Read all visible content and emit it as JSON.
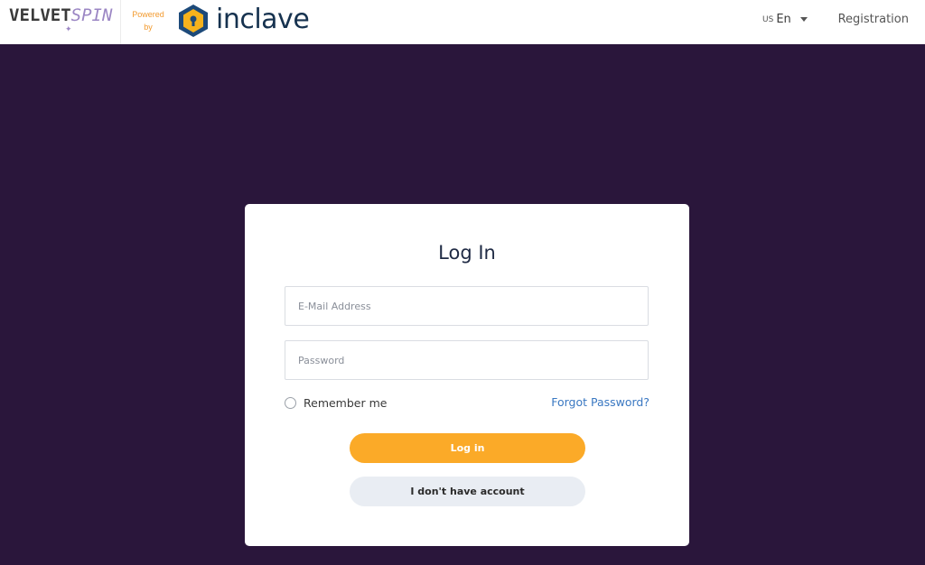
{
  "header": {
    "brand": {
      "part1": "VELVET",
      "part2": "SPIN"
    },
    "powered_by": {
      "line1": "Powered",
      "line2": "by"
    },
    "partner": "inclave",
    "language": {
      "flag": "US",
      "label": "En"
    },
    "registration": "Registration"
  },
  "login": {
    "title": "Log In",
    "email_placeholder": "E-Mail Address",
    "password_placeholder": "Password",
    "remember_label": "Remember me",
    "forgot_label": "Forgot Password?",
    "login_button": "Log in",
    "no_account_button": "I don't have account"
  },
  "colors": {
    "background": "#2a163b",
    "accent": "#fbaa28",
    "link": "#3a78c2",
    "secondary_button": "#e9edf3"
  }
}
